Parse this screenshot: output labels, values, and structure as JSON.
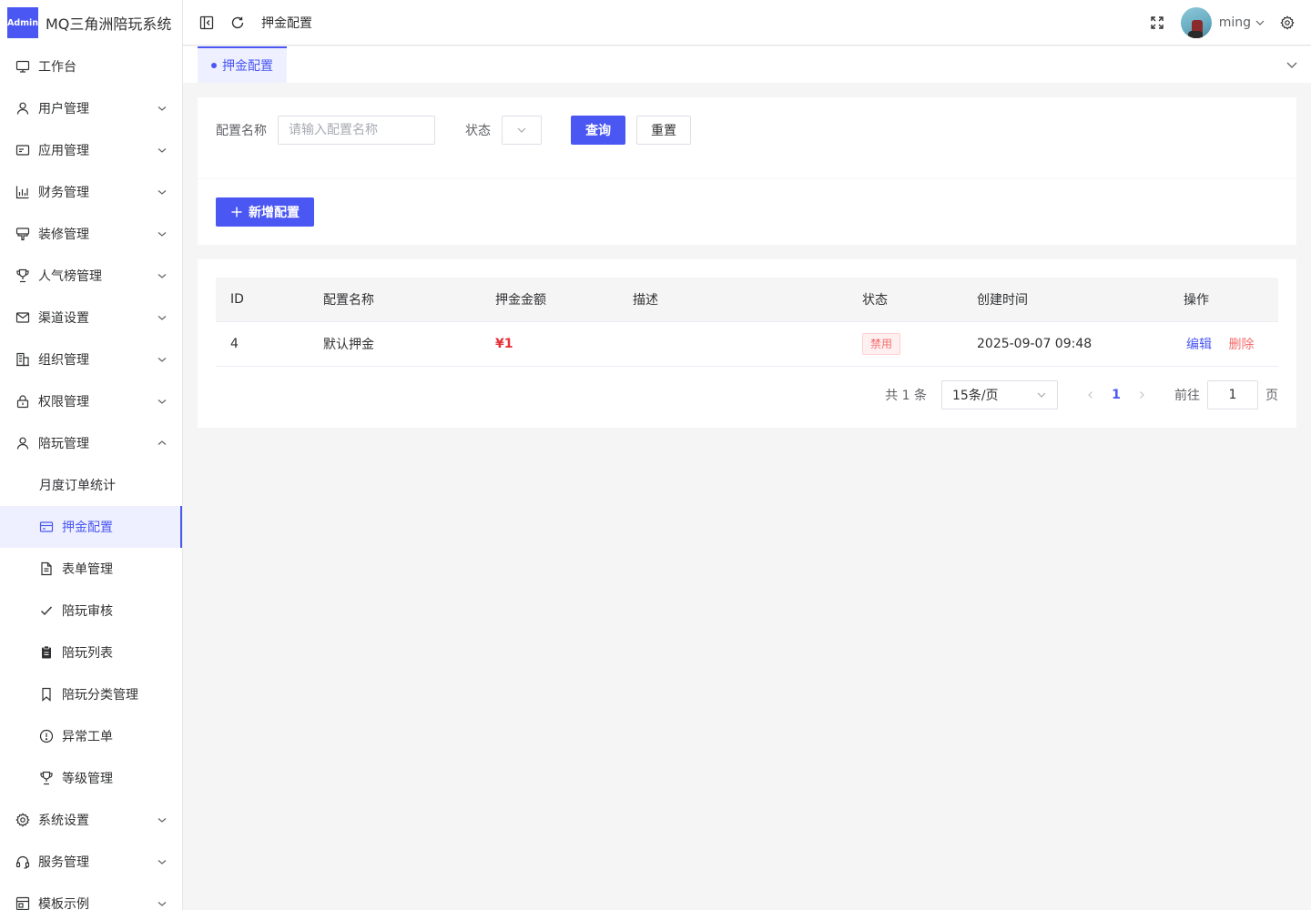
{
  "app": {
    "logo_badge": "Admin",
    "title": "MQ三角洲陪玩系统"
  },
  "sidebar": {
    "items": [
      {
        "label": "工作台",
        "icon": "monitor-icon",
        "expandable": false
      },
      {
        "label": "用户管理",
        "icon": "user-icon",
        "expandable": true
      },
      {
        "label": "应用管理",
        "icon": "app-card-icon",
        "expandable": true
      },
      {
        "label": "财务管理",
        "icon": "bar-chart-icon",
        "expandable": true
      },
      {
        "label": "装修管理",
        "icon": "brush-icon",
        "expandable": true
      },
      {
        "label": "人气榜管理",
        "icon": "trophy-icon",
        "expandable": true
      },
      {
        "label": "渠道设置",
        "icon": "mail-icon",
        "expandable": true
      },
      {
        "label": "组织管理",
        "icon": "building-icon",
        "expandable": true
      },
      {
        "label": "权限管理",
        "icon": "lock-icon",
        "expandable": true
      },
      {
        "label": "陪玩管理",
        "icon": "user-icon",
        "expandable": true,
        "expanded": true
      }
    ],
    "subitems": [
      {
        "label": "月度订单统计",
        "icon": "",
        "active": false
      },
      {
        "label": "押金配置",
        "icon": "credit-card-icon",
        "active": true
      },
      {
        "label": "表单管理",
        "icon": "document-icon",
        "active": false
      },
      {
        "label": "陪玩审核",
        "icon": "check-icon",
        "active": false
      },
      {
        "label": "陪玩列表",
        "icon": "clipboard-icon",
        "active": false
      },
      {
        "label": "陪玩分类管理",
        "icon": "bookmark-icon",
        "active": false
      },
      {
        "label": "异常工单",
        "icon": "warning-circle-icon",
        "active": false
      },
      {
        "label": "等级管理",
        "icon": "trophy-icon",
        "active": false
      }
    ],
    "bottom_items": [
      {
        "label": "系统设置",
        "icon": "gear-icon",
        "expandable": true
      },
      {
        "label": "服务管理",
        "icon": "headset-icon",
        "expandable": true
      },
      {
        "label": "模板示例",
        "icon": "template-icon",
        "expandable": true
      }
    ]
  },
  "header": {
    "breadcrumb": "押金配置",
    "user_name": "ming"
  },
  "tabs": [
    {
      "label": "押金配置",
      "active": true
    }
  ],
  "search": {
    "name_label": "配置名称",
    "name_placeholder": "请输入配置名称",
    "name_value": "",
    "status_label": "状态",
    "status_value": "",
    "query_button": "查询",
    "reset_button": "重置"
  },
  "toolbar": {
    "add_button": "新增配置"
  },
  "table": {
    "columns": [
      "ID",
      "配置名称",
      "押金金额",
      "描述",
      "状态",
      "创建时间",
      "操作"
    ],
    "rows": [
      {
        "id": "4",
        "name": "默认押金",
        "amount": "¥1",
        "description": "",
        "status": "禁用",
        "created_at": "2025-09-07 09:48",
        "edit": "编辑",
        "delete": "删除"
      }
    ]
  },
  "pagination": {
    "total_text": "共 1 条",
    "page_size": "15条/页",
    "current_page": "1",
    "goto_label": "前往",
    "goto_value": "1",
    "page_suffix": "页"
  },
  "colors": {
    "primary": "#4b57f2",
    "danger": "#f56c6c",
    "price": "#e5323a",
    "background": "#f5f5f5"
  }
}
